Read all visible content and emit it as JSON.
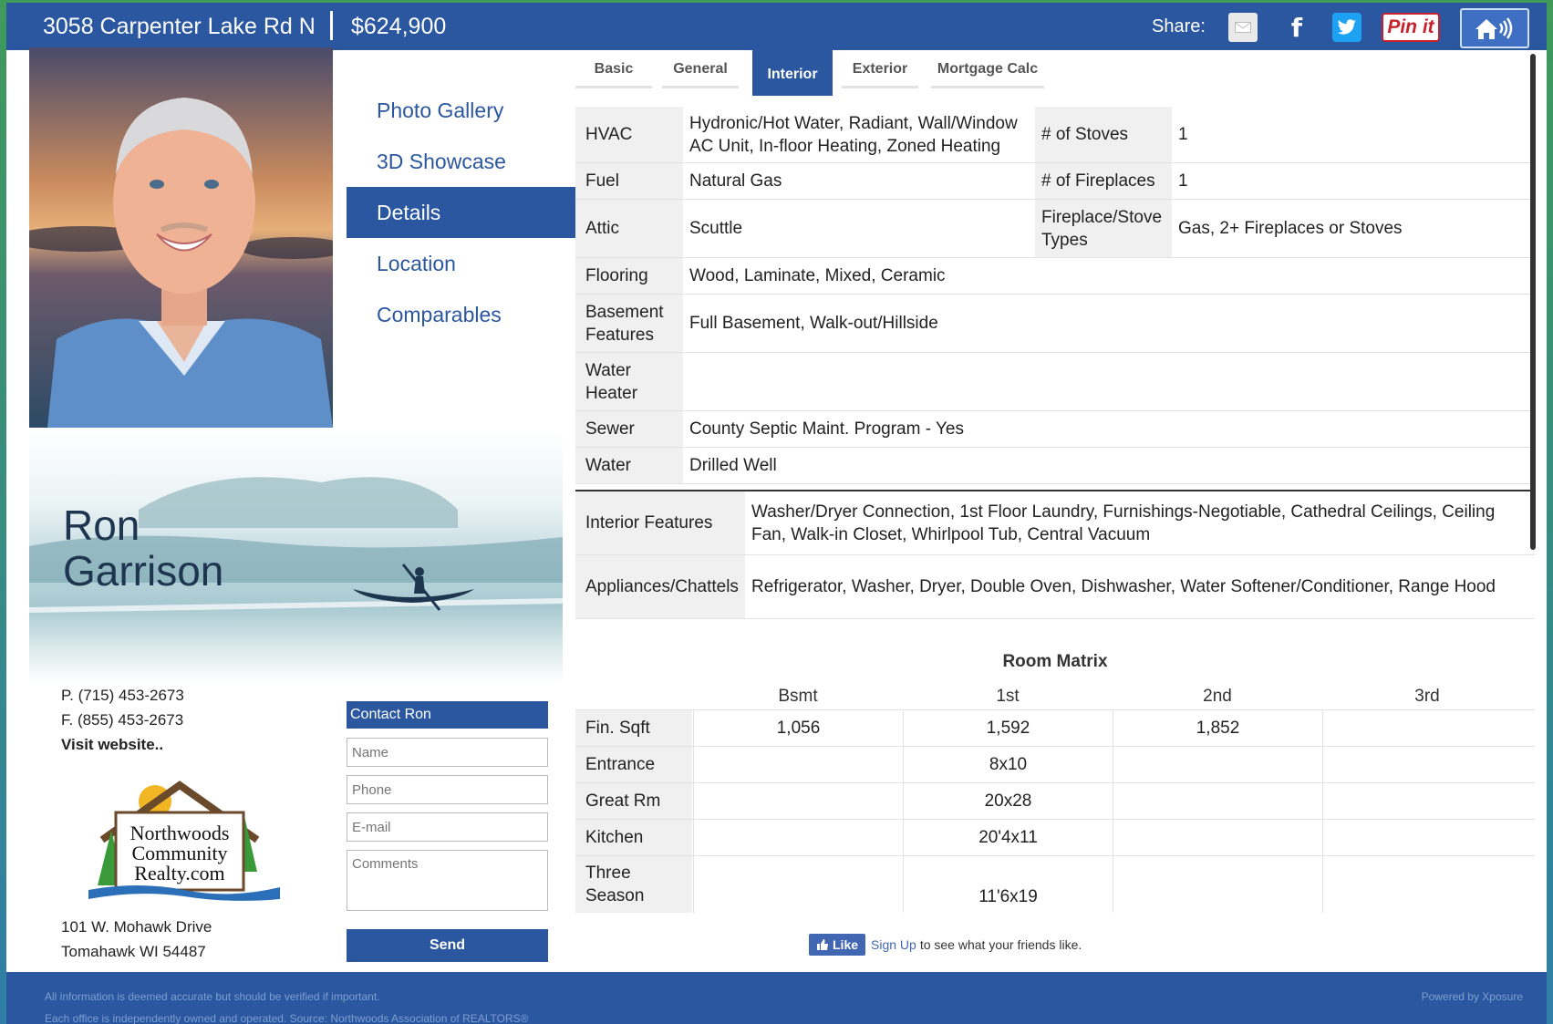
{
  "header": {
    "address": "3058 Carpenter Lake Rd N",
    "price": "$624,900",
    "share_label": "Share:",
    "pin_label": "Pin it"
  },
  "sidenav": {
    "items": [
      {
        "label": "Photo Gallery",
        "active": false
      },
      {
        "label": "3D Showcase",
        "active": false
      },
      {
        "label": "Details",
        "active": true
      },
      {
        "label": "Location",
        "active": false
      },
      {
        "label": "Comparables",
        "active": false
      }
    ]
  },
  "agent": {
    "first_name": "Ron",
    "last_name": "Garrison",
    "phone": "P. (715) 453-2673",
    "fax": "F. (855) 453-2673",
    "website_link": "Visit website..",
    "logo_text": [
      "Northwoods",
      "Community",
      "Realty.com"
    ],
    "office_line1": "101 W. Mohawk Drive",
    "office_line2": "Tomahawk WI 54487"
  },
  "contact_form": {
    "title": "Contact Ron",
    "name_placeholder": "Name",
    "phone_placeholder": "Phone",
    "email_placeholder": "E-mail",
    "comments_placeholder": "Comments",
    "send_label": "Send"
  },
  "tabs": [
    {
      "label": "Basic",
      "active": false
    },
    {
      "label": "General",
      "active": false
    },
    {
      "label": "Interior",
      "active": true
    },
    {
      "label": "Exterior",
      "active": false
    },
    {
      "label": "Mortgage Calc",
      "active": false
    }
  ],
  "details": {
    "hvac_label": "HVAC",
    "hvac_value": "Hydronic/Hot Water, Radiant, Wall/Window AC Unit, In-floor Heating, Zoned Heating",
    "stoves_label": "# of Stoves",
    "stoves_value": "1",
    "fuel_label": "Fuel",
    "fuel_value": "Natural Gas",
    "fireplaces_label": "# of Fireplaces",
    "fireplaces_value": "1",
    "attic_label": "Attic",
    "attic_value": "Scuttle",
    "fptypes_label": "Fireplace/Stove Types",
    "fptypes_value": "Gas, 2+ Fireplaces or Stoves",
    "flooring_label": "Flooring",
    "flooring_value": "Wood, Laminate, Mixed, Ceramic",
    "basement_label": "Basement Features",
    "basement_value": "Full Basement, Walk-out/Hillside",
    "water_heater_label": "Water Heater",
    "water_heater_value": "",
    "sewer_label": "Sewer",
    "sewer_value": "County Septic Maint. Program - Yes",
    "water_label": "Water",
    "water_value": "Drilled Well",
    "interior_features_label": "Interior Features",
    "interior_features_value": "Washer/Dryer Connection, 1st Floor Laundry, Furnishings-Negotiable, Cathedral Ceilings, Ceiling Fan, Walk-in Closet, Whirlpool Tub, Central Vacuum",
    "appliances_label": "Appliances/Chattels",
    "appliances_value": "Refrigerator, Washer, Dryer, Double Oven, Dishwasher, Water Softener/Conditioner, Range Hood"
  },
  "room_matrix": {
    "title": "Room Matrix",
    "columns": [
      "Bsmt",
      "1st",
      "2nd",
      "3rd"
    ],
    "rows": [
      {
        "label": "Fin. Sqft",
        "cells": [
          "1,056",
          "1,592",
          "1,852",
          ""
        ]
      },
      {
        "label": "Entrance",
        "cells": [
          "",
          "8x10",
          "",
          ""
        ]
      },
      {
        "label": "Great Rm",
        "cells": [
          "",
          "20x28",
          "",
          ""
        ]
      },
      {
        "label": "Kitchen",
        "cells": [
          "",
          "20'4x11",
          "",
          ""
        ]
      },
      {
        "label": "Three Season",
        "cells": [
          "",
          "11'6x19",
          "",
          ""
        ]
      }
    ]
  },
  "facebook": {
    "like_label": "Like",
    "signup_label": "Sign Up",
    "signup_text": "to see what your friends like."
  },
  "footer": {
    "line1": "All information is deemed accurate but should be verified if important.",
    "line2": "Each office is independently owned and operated. Source: Northwoods Association of REALTORS®",
    "powered": "Powered by Xposure"
  },
  "colors": {
    "brand_blue": "#2a579f",
    "label_gray": "#f0f0f0",
    "twitter": "#1da1f2",
    "pinterest": "#c8232c",
    "facebook": "#4267b2"
  },
  "icons": [
    "mail-icon",
    "facebook-icon",
    "twitter-icon",
    "pinterest-icon",
    "home-audio-icon",
    "thumbs-up-icon",
    "canoe-icon"
  ]
}
